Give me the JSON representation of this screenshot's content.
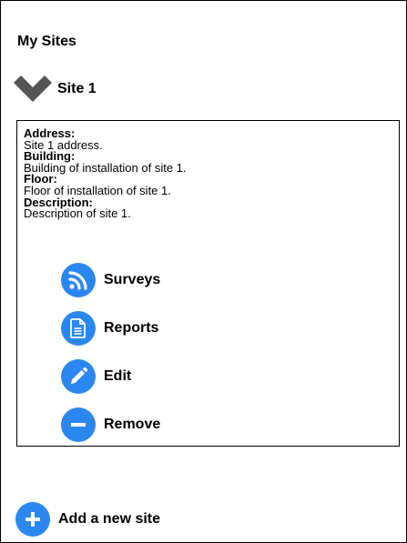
{
  "page": {
    "title": "My Sites"
  },
  "site": {
    "name": "Site 1",
    "fields": [
      {
        "label": "Address:",
        "value": "Site 1 address."
      },
      {
        "label": "Building:",
        "value": "Building of installation of site 1."
      },
      {
        "label": "Floor:",
        "value": "Floor of installation of site 1."
      },
      {
        "label": "Description:",
        "value": "Description of site 1."
      }
    ],
    "actions": [
      {
        "label": "Surveys",
        "icon": "rss-icon"
      },
      {
        "label": "Reports",
        "icon": "document-icon"
      },
      {
        "label": "Edit",
        "icon": "pencil-icon"
      },
      {
        "label": "Remove",
        "icon": "minus-icon"
      }
    ]
  },
  "footer": {
    "add_label": "Add a new site",
    "add_icon": "plus-icon"
  },
  "colors": {
    "accent": "#2b87f0",
    "chevron": "#555555",
    "text": "#000000"
  }
}
